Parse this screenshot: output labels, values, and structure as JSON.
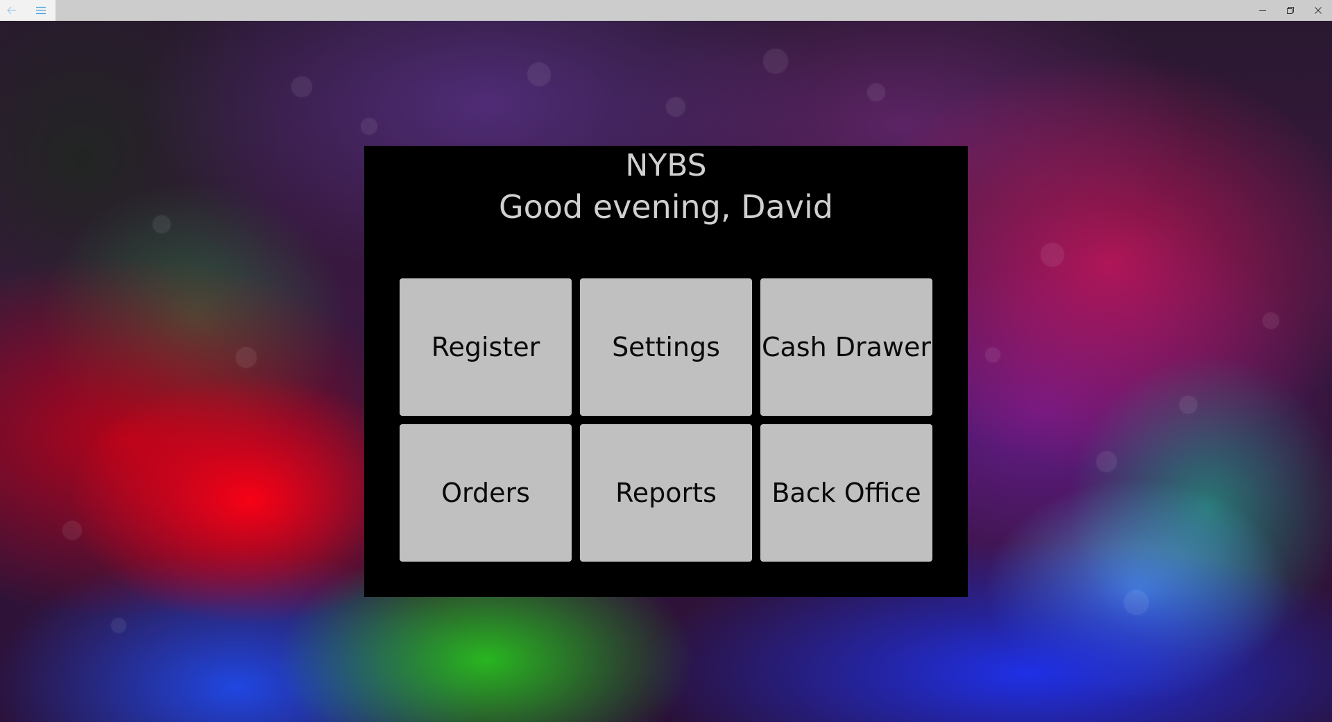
{
  "titlebar": {
    "back_icon": "arrow-left-icon",
    "menu_icon": "hamburger-menu-icon",
    "minimize_icon": "minimize-icon",
    "maximize_icon": "restore-icon",
    "close_icon": "close-icon",
    "accent_color": "#4aa3df"
  },
  "panel": {
    "company_name": "NYBS",
    "greeting": "Good evening, David"
  },
  "tiles": [
    {
      "label": "Register"
    },
    {
      "label": "Settings"
    },
    {
      "label": "Cash Drawer"
    },
    {
      "label": "Orders"
    },
    {
      "label": "Reports"
    },
    {
      "label": "Back Office"
    }
  ],
  "colors": {
    "panel_bg": "#000000",
    "tile_bg": "#c0c0c0",
    "header_text": "#d0d0d0",
    "tile_text": "#0a0a0a"
  }
}
